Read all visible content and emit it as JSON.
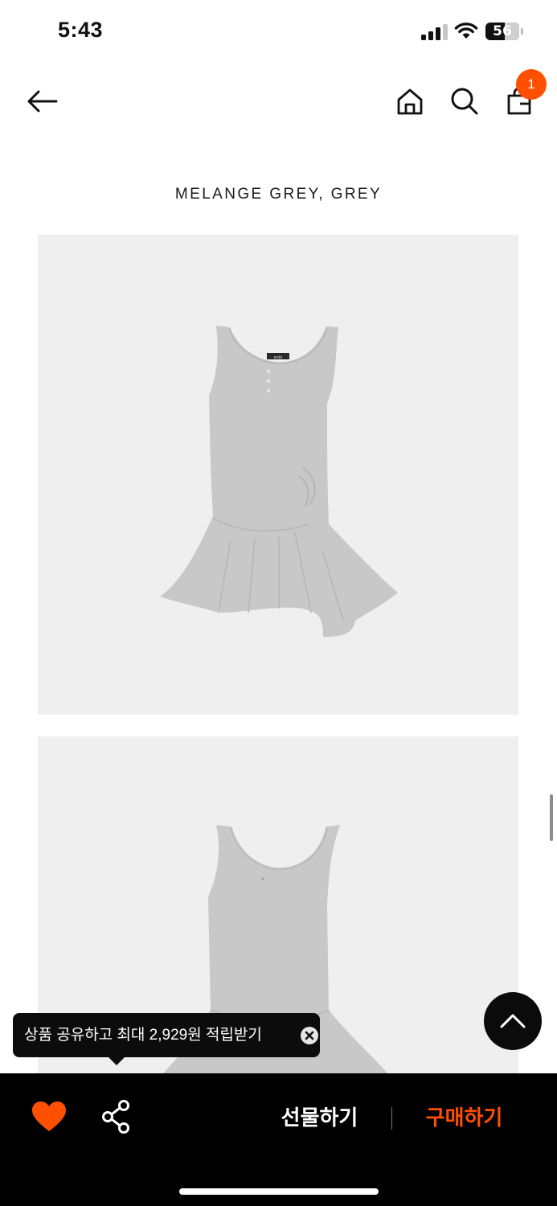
{
  "status": {
    "time": "5:43",
    "battery": "56",
    "battery_level": 0.56
  },
  "header": {
    "cart_count": "1"
  },
  "product": {
    "color_title": "MELANGE GREY, GREY",
    "image_label": "enbi"
  },
  "tooltip": {
    "text": "상품 공유하고 최대 2,929원 적립받기"
  },
  "bottom_bar": {
    "gift_label": "선물하기",
    "buy_label": "구매하기"
  },
  "colors": {
    "accent": "#ff4f00",
    "bar_bg": "#000000",
    "image_bg": "#efefef",
    "dress_grey": "#c4c4c4"
  },
  "icons": [
    "signal-icon",
    "wifi-icon",
    "battery-icon",
    "back-arrow-icon",
    "home-icon",
    "search-icon",
    "shopping-bag-icon",
    "close-icon",
    "chevron-up-icon",
    "heart-icon",
    "share-icon"
  ]
}
